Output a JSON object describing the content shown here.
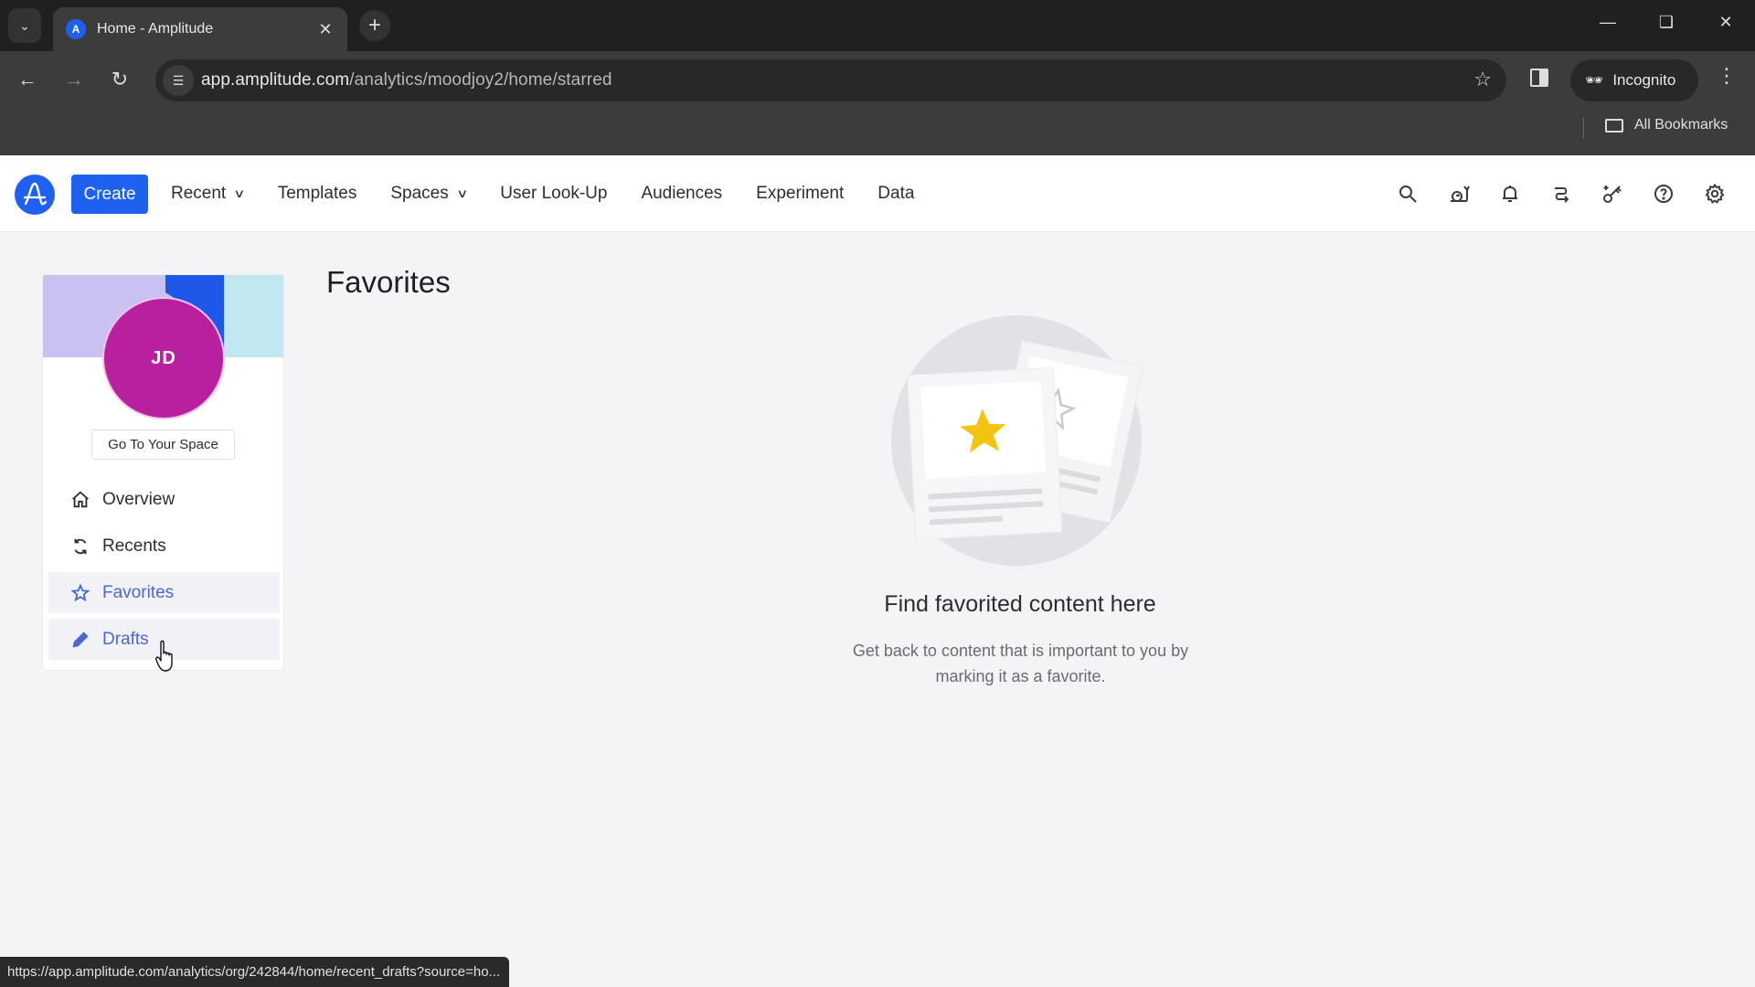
{
  "browser": {
    "tab": {
      "title": "Home - Amplitude",
      "favicon": "amplitude-logo-icon",
      "close_icon": "close-icon"
    },
    "new_tab_icon": "plus-icon",
    "tab_search_icon": "chevron-down-icon",
    "window_controls": {
      "minimize": "minimize-icon",
      "restore": "restore-icon",
      "close": "close-icon"
    },
    "url": {
      "host": "app.amplitude.com",
      "path": "/analytics/moodjoy2/home/starred"
    },
    "incognito_label": "Incognito",
    "bookmarks_label": "All Bookmarks",
    "status_url": "https://app.amplitude.com/analytics/org/242844/home/recent_drafts?source=ho..."
  },
  "header": {
    "create_label": "Create",
    "nav": [
      {
        "label": "Recent",
        "dropdown": true
      },
      {
        "label": "Templates",
        "dropdown": false
      },
      {
        "label": "Spaces",
        "dropdown": true
      },
      {
        "label": "User Look-Up",
        "dropdown": false
      },
      {
        "label": "Audiences",
        "dropdown": false
      },
      {
        "label": "Experiment",
        "dropdown": false
      },
      {
        "label": "Data",
        "dropdown": false
      }
    ],
    "icons": [
      "search-icon",
      "snail-icon",
      "bell-icon",
      "switch-icon",
      "key-sparkle-icon",
      "help-icon",
      "gear-icon"
    ]
  },
  "sidebar": {
    "avatar_initials": "JD",
    "space_button": "Go To Your Space",
    "items": [
      {
        "label": "Overview",
        "icon": "home-icon",
        "state": "default"
      },
      {
        "label": "Recents",
        "icon": "refresh-icon",
        "state": "default"
      },
      {
        "label": "Favorites",
        "icon": "star-icon",
        "state": "active"
      },
      {
        "label": "Drafts",
        "icon": "pencil-icon",
        "state": "hover"
      }
    ]
  },
  "main": {
    "title": "Favorites",
    "empty_state": {
      "title": "Find favorited content here",
      "description": "Get back to content that is important to you by marking it as a favorite."
    }
  },
  "colors": {
    "brand": "#1e61f0",
    "avatar": "#b8209f",
    "active_nav": "#4a67d6",
    "star": "#f2c40f"
  }
}
